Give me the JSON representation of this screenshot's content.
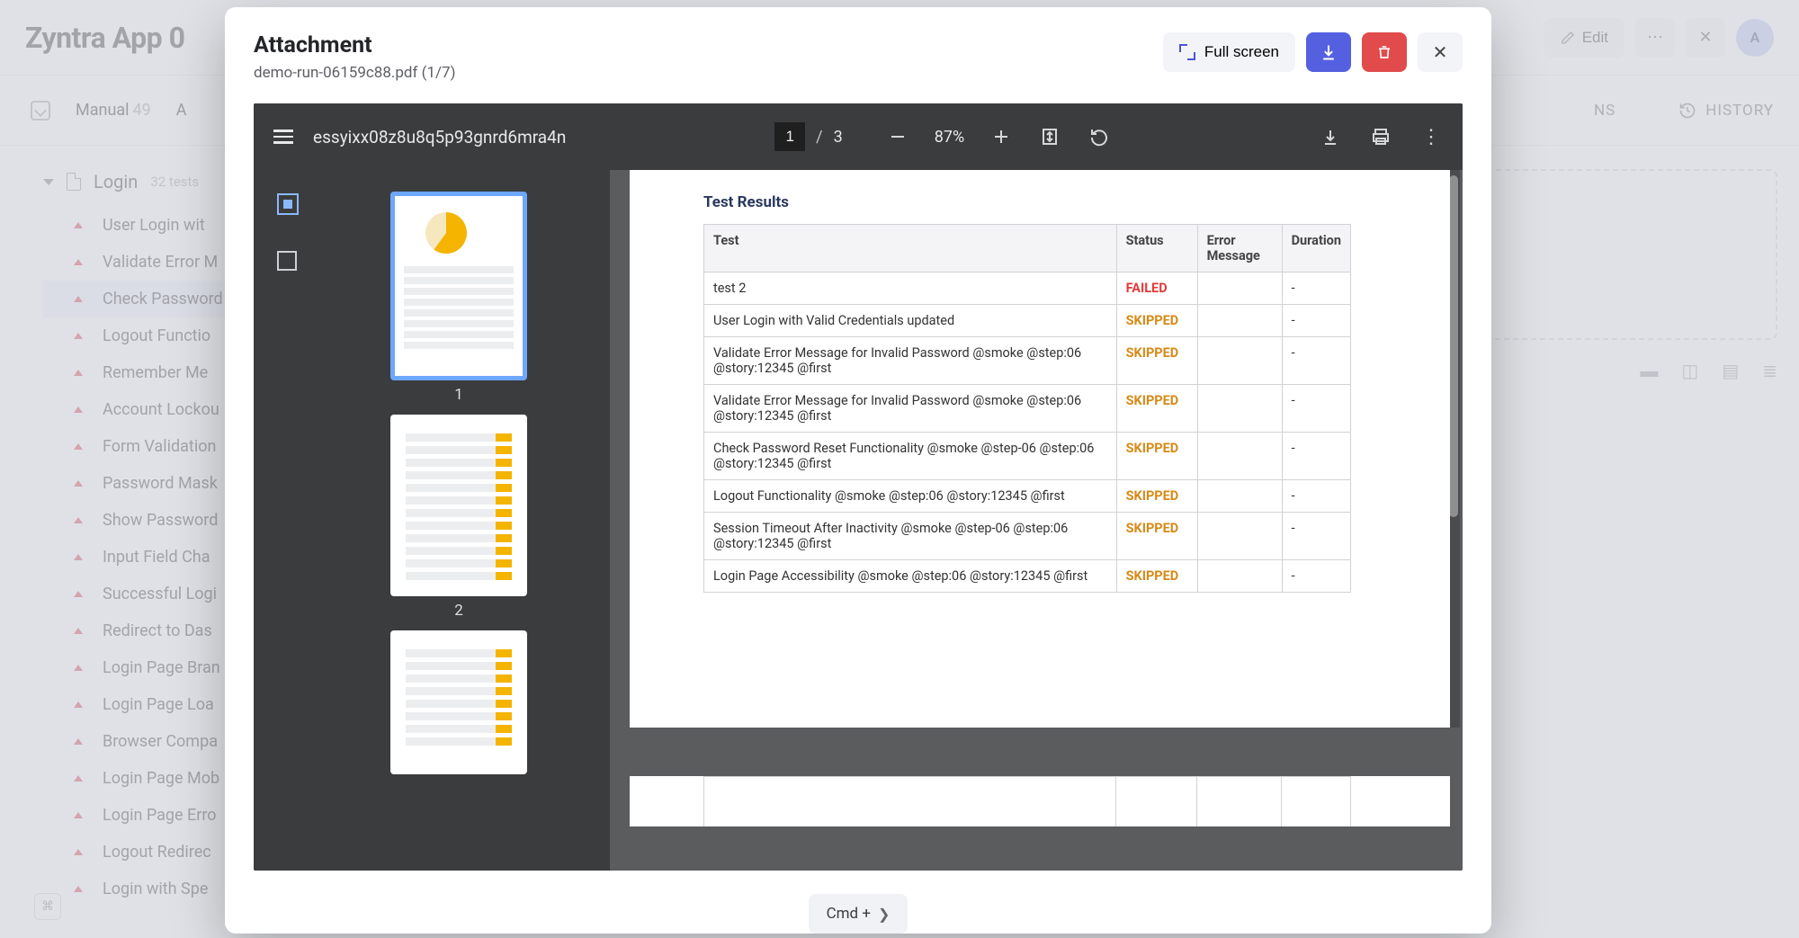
{
  "header": {
    "title": "Zyntra App 0",
    "edit": "Edit",
    "avatar": "A"
  },
  "subbar": {
    "manual_label": "Manual",
    "manual_count": "49",
    "other_tab_first_letter": "A"
  },
  "right_tabs": {
    "ns": "NS",
    "history": "HISTORY"
  },
  "tree": {
    "title": "Login",
    "count": "32 tests",
    "items": [
      "User Login wit",
      "Validate Error M",
      "Check Password",
      "Logout Functio",
      "Remember Me",
      "Account Lockou",
      "Form Validation",
      "Password Mask",
      "Show Password",
      "Input Field Cha",
      "Successful Logi",
      "Redirect to Das",
      "Login Page Bran",
      "Login Page Loa",
      "Browser Compa",
      "Login Page Mob",
      "Login Page Erro",
      "Logout Redirec",
      "Login with Spe"
    ],
    "active_index": 2
  },
  "modal": {
    "title": "Attachment",
    "subtitle": "demo-run-06159c88.pdf (1/7)",
    "full_screen": "Full screen",
    "nav_hint": "Cmd + "
  },
  "pdf": {
    "name": "essyixx08z8u8q5p93gnrd6mra4n",
    "page_input": "1",
    "page_total": "3",
    "zoom": "87%",
    "thumb_labels": [
      "1",
      "2"
    ]
  },
  "report": {
    "heading": "Test Results",
    "cols": {
      "test": "Test",
      "status": "Status",
      "err": "Error Message",
      "dur": "Duration"
    },
    "rows": [
      {
        "t": "test 2",
        "s": "FAILED",
        "d": "-"
      },
      {
        "t": "User Login with Valid Credentials updated",
        "s": "SKIPPED",
        "d": "-"
      },
      {
        "t": "Validate Error Message for Invalid Password @smoke @step:06 @story:12345 @first",
        "s": "SKIPPED",
        "d": "-"
      },
      {
        "t": "Validate Error Message for Invalid Password @smoke @step:06 @story:12345 @first",
        "s": "SKIPPED",
        "d": "-"
      },
      {
        "t": "Check Password Reset Functionality @smoke @step-06 @step:06 @story:12345 @first",
        "s": "SKIPPED",
        "d": "-"
      },
      {
        "t": "Logout Functionality @smoke @step:06 @story:12345 @first",
        "s": "SKIPPED",
        "d": "-"
      },
      {
        "t": "Session Timeout After Inactivity @smoke @step-06 @step:06 @story:12345 @first",
        "s": "SKIPPED",
        "d": "-"
      },
      {
        "t": "Login Page Accessibility @smoke @step:06 @story:12345 @first",
        "s": "SKIPPED",
        "d": "-"
      }
    ]
  }
}
